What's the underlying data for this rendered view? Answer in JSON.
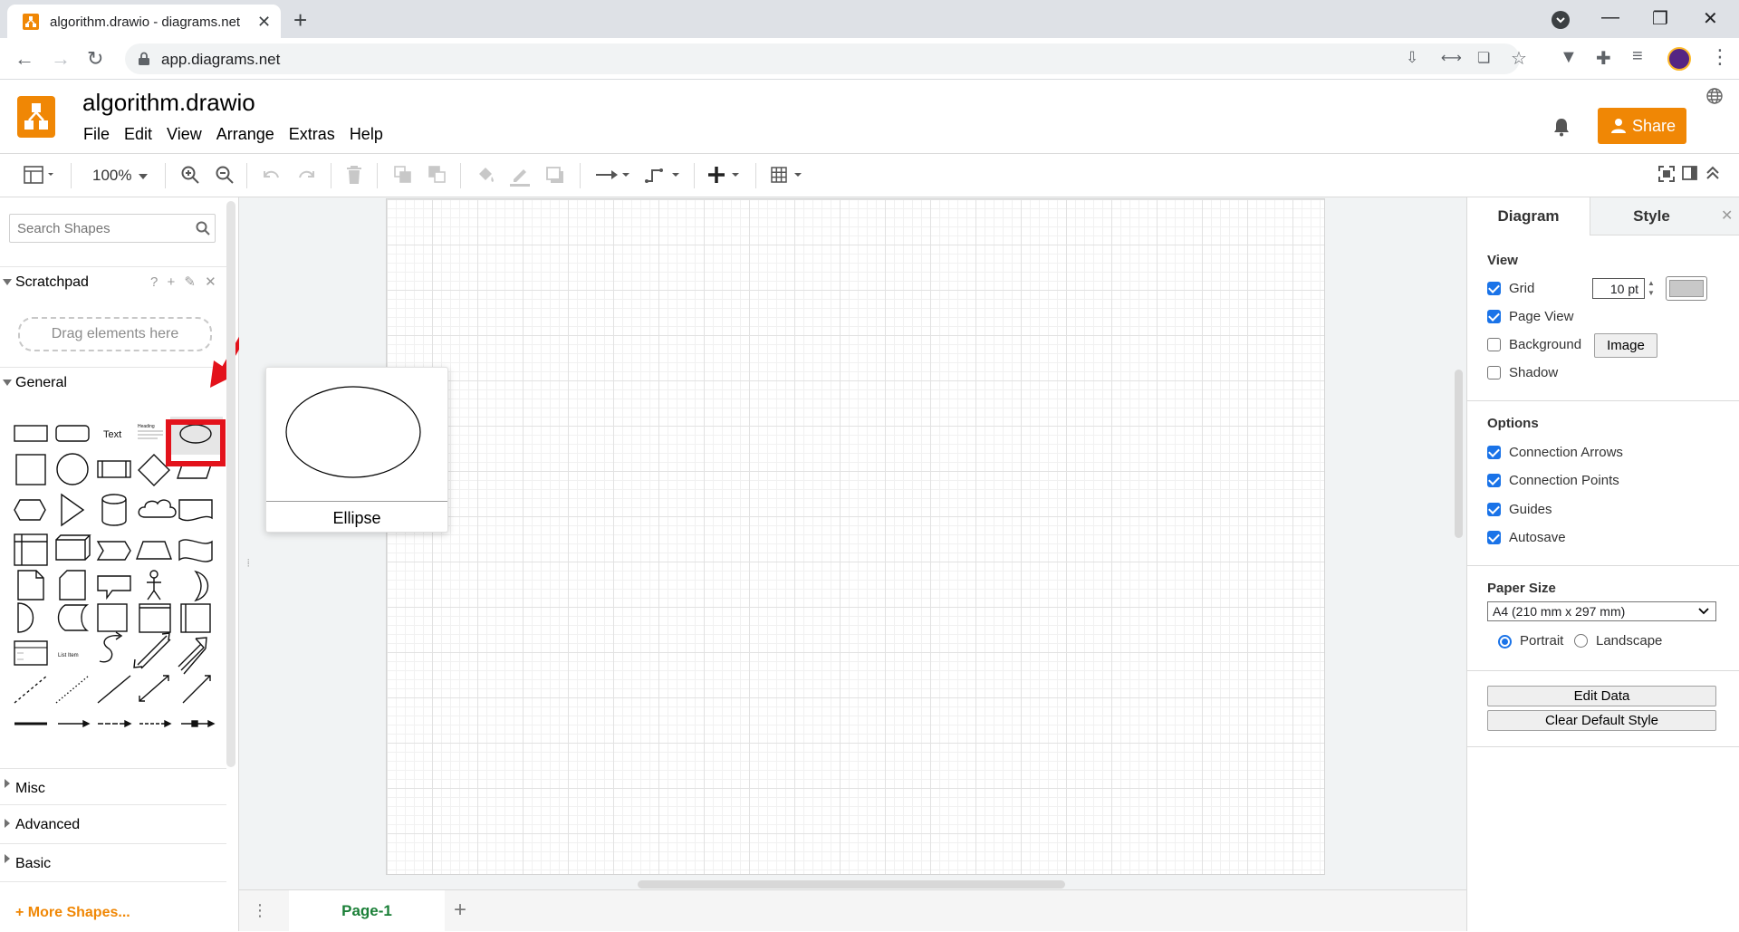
{
  "browser": {
    "tab_title": "algorithm.drawio - diagrams.net",
    "url": "app.diagrams.net"
  },
  "app": {
    "doc_title": "algorithm.drawio",
    "menu": [
      "File",
      "Edit",
      "View",
      "Arrange",
      "Extras",
      "Help"
    ],
    "share_label": "Share",
    "brand_color": "#f08705"
  },
  "toolbar": {
    "zoom": "100%"
  },
  "left_panel": {
    "search_placeholder": "Search Shapes",
    "scratchpad_label": "Scratchpad",
    "scratchpad_tools": "? + ✎ ✕",
    "dropzone_label": "Drag elements here",
    "general_label": "General",
    "shape_text_label": "Text",
    "shape_heading_label": "Heading",
    "shape_list_item_label": "List Item",
    "collapsed_sections": [
      "Misc",
      "Advanced",
      "Basic"
    ],
    "more_shapes_label": "+ More Shapes..."
  },
  "preview": {
    "caption": "Ellipse"
  },
  "pages": {
    "tabs": [
      "Page-1"
    ]
  },
  "right_panel": {
    "tabs": [
      "Diagram",
      "Style"
    ],
    "view_label": "View",
    "grid_label": "Grid",
    "grid_size": "10 pt",
    "page_view_label": "Page View",
    "background_label": "Background",
    "image_button": "Image",
    "shadow_label": "Shadow",
    "options_label": "Options",
    "options": [
      {
        "label": "Connection Arrows",
        "checked": true
      },
      {
        "label": "Connection Points",
        "checked": true
      },
      {
        "label": "Guides",
        "checked": true
      },
      {
        "label": "Autosave",
        "checked": true
      }
    ],
    "paper_size_label": "Paper Size",
    "paper_size_value": "A4 (210 mm x 297 mm)",
    "portrait_label": "Portrait",
    "landscape_label": "Landscape",
    "edit_data_button": "Edit Data",
    "clear_style_button": "Clear Default Style"
  },
  "annotation_color": "#e3121b"
}
